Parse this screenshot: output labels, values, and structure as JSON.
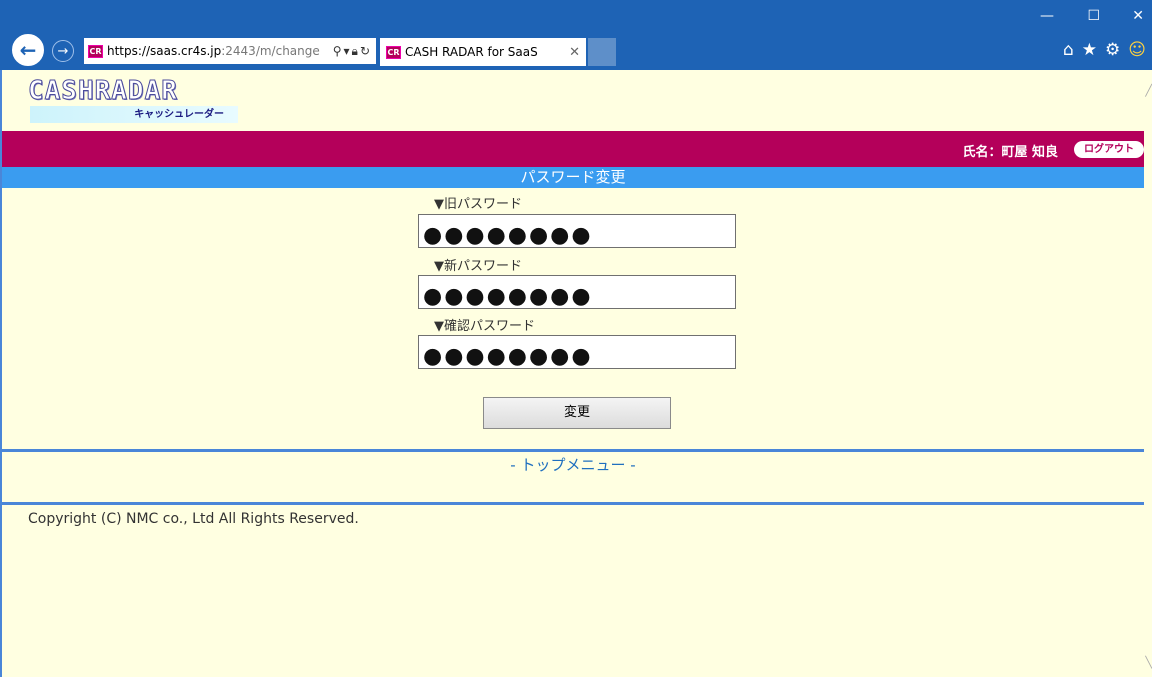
{
  "browser": {
    "url_host": "https://saas.cr4s.jp",
    "url_rest": ":2443/m/change",
    "tab_title": "CASH RADAR for SaaS",
    "favicon_text": "CR",
    "window_min": "—",
    "window_max": "☐",
    "window_close": "✕"
  },
  "logo": {
    "text": "CASHRADAR",
    "sub": "キャッシュレーダー"
  },
  "user": {
    "name_label": "氏名：町屋 知良",
    "logout_label": "ログアウト"
  },
  "page": {
    "title": "パスワード変更"
  },
  "form": {
    "fields": [
      {
        "label": "▼旧パスワード",
        "value": "●●●●●●●●"
      },
      {
        "label": "▼新パスワード",
        "value": "●●●●●●●●"
      },
      {
        "label": "▼確認パスワード",
        "value": "●●●●●●●●"
      }
    ],
    "submit_label": "変更"
  },
  "nav": {
    "top_menu_prefix": "- ",
    "top_menu_label": "トップメニュー",
    "top_menu_suffix": " -"
  },
  "footer": {
    "copyright": "Copyright (C) NMC co., Ltd All Rights Reserved."
  },
  "colors": {
    "chrome": "#1e63b5",
    "userbar": "#b4005a",
    "titlebar": "#3a9cf0",
    "page_bg": "#ffffe1",
    "link": "#1f6fbf"
  }
}
